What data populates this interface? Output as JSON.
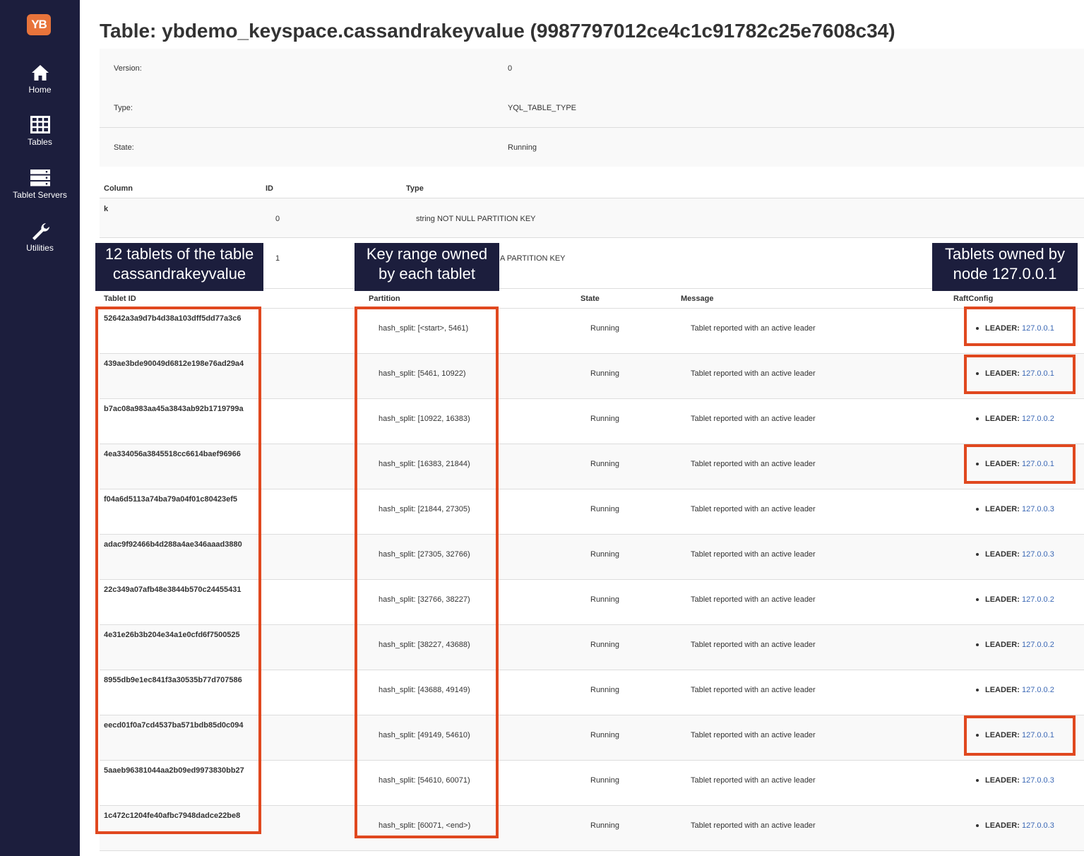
{
  "logo": {
    "text": "YB"
  },
  "sidebar": {
    "items": [
      {
        "label": "Home",
        "icon": "home-icon"
      },
      {
        "label": "Tables",
        "icon": "table-icon"
      },
      {
        "label": "Tablet Servers",
        "icon": "server-icon"
      },
      {
        "label": "Utilities",
        "icon": "wrench-icon"
      }
    ]
  },
  "title": "Table: ybdemo_keyspace.cassandrakeyvalue (9987797012ce4c1c91782c25e7608c34)",
  "info": [
    {
      "label": "Version:",
      "value": "0"
    },
    {
      "label": "Type:",
      "value": "YQL_TABLE_TYPE"
    },
    {
      "label": "State:",
      "value": "Running"
    }
  ],
  "schema": {
    "headers": [
      "Column",
      "ID",
      "Type"
    ],
    "rows": [
      {
        "column": "k",
        "id": "0",
        "type": "string NOT NULL PARTITION KEY"
      },
      {
        "column": "",
        "id": "1",
        "type": "A PARTITION KEY"
      }
    ]
  },
  "tablets": {
    "headers": [
      "Tablet ID",
      "Partition",
      "State",
      "Message",
      "RaftConfig"
    ],
    "leader_label": "LEADER:",
    "rows": [
      {
        "id": "52642a3a9d7b4d38a103dff5dd77a3c6",
        "partition": "hash_split: [<start>, 5461)",
        "state": "Running",
        "message": "Tablet reported with an active leader",
        "leader": "127.0.0.1"
      },
      {
        "id": "439ae3bde90049d6812e198e76ad29a4",
        "partition": "hash_split: [5461, 10922)",
        "state": "Running",
        "message": "Tablet reported with an active leader",
        "leader": "127.0.0.1"
      },
      {
        "id": "b7ac08a983aa45a3843ab92b1719799a",
        "partition": "hash_split: [10922, 16383)",
        "state": "Running",
        "message": "Tablet reported with an active leader",
        "leader": "127.0.0.2"
      },
      {
        "id": "4ea334056a3845518cc6614baef96966",
        "partition": "hash_split: [16383, 21844)",
        "state": "Running",
        "message": "Tablet reported with an active leader",
        "leader": "127.0.0.1"
      },
      {
        "id": "f04a6d5113a74ba79a04f01c80423ef5",
        "partition": "hash_split: [21844, 27305)",
        "state": "Running",
        "message": "Tablet reported with an active leader",
        "leader": "127.0.0.3"
      },
      {
        "id": "adac9f92466b4d288a4ae346aaad3880",
        "partition": "hash_split: [27305, 32766)",
        "state": "Running",
        "message": "Tablet reported with an active leader",
        "leader": "127.0.0.3"
      },
      {
        "id": "22c349a07afb48e3844b570c24455431",
        "partition": "hash_split: [32766, 38227)",
        "state": "Running",
        "message": "Tablet reported with an active leader",
        "leader": "127.0.0.2"
      },
      {
        "id": "4e31e26b3b204e34a1e0cfd6f7500525",
        "partition": "hash_split: [38227, 43688)",
        "state": "Running",
        "message": "Tablet reported with an active leader",
        "leader": "127.0.0.2"
      },
      {
        "id": "8955db9e1ec841f3a30535b77d707586",
        "partition": "hash_split: [43688, 49149)",
        "state": "Running",
        "message": "Tablet reported with an active leader",
        "leader": "127.0.0.2"
      },
      {
        "id": "eecd01f0a7cd4537ba571bdb85d0c094",
        "partition": "hash_split: [49149, 54610)",
        "state": "Running",
        "message": "Tablet reported with an active leader",
        "leader": "127.0.0.1"
      },
      {
        "id": "5aaeb96381044aa2b09ed9973830bb27",
        "partition": "hash_split: [54610, 60071)",
        "state": "Running",
        "message": "Tablet reported with an active leader",
        "leader": "127.0.0.3"
      },
      {
        "id": "1c472c1204fe40afbc7948dadce22be8",
        "partition": "hash_split: [60071, <end>)",
        "state": "Running",
        "message": "Tablet reported with an active leader",
        "leader": "127.0.0.3"
      }
    ]
  },
  "annotations": {
    "tablets_callout": [
      "12 tablets of the table",
      "cassandrakeyvalue"
    ],
    "partition_callout": [
      "Key range owned",
      "by each tablet"
    ],
    "node_callout": [
      "Tablets owned by",
      "node 127.0.0.1"
    ],
    "accent_color": "#e0481f",
    "callout_bg": "#1c1e3d"
  }
}
